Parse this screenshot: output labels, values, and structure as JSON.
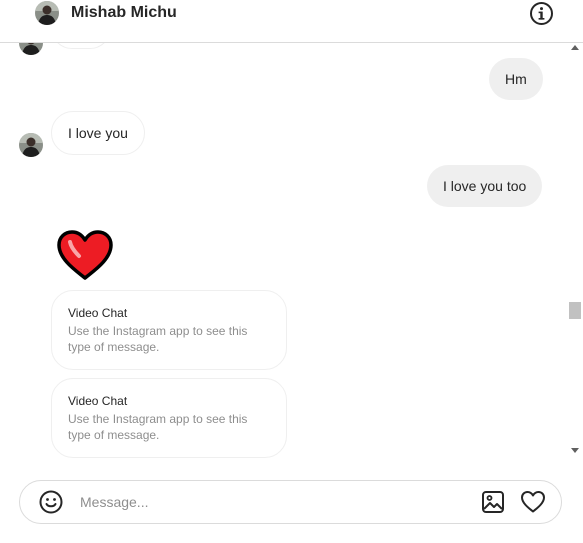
{
  "header": {
    "contact_name": "Mishab Michu",
    "avatar_icon": "profile-avatar",
    "info_icon": "info-icon"
  },
  "thread": {
    "messages": [
      {
        "direction": "outgoing",
        "text": "Hm"
      },
      {
        "direction": "incoming",
        "text": "I love you"
      },
      {
        "direction": "outgoing",
        "text": "I love you too"
      },
      {
        "direction": "incoming",
        "type": "emoji",
        "icon": "red-heart-icon"
      },
      {
        "direction": "incoming",
        "type": "card",
        "title": "Video Chat",
        "body": "Use the Instagram app to see this type of message."
      },
      {
        "direction": "incoming",
        "type": "card",
        "title": "Video Chat",
        "body": "Use the Instagram app to see this type of message."
      }
    ]
  },
  "composer": {
    "placeholder": "Message...",
    "emoji_icon": "smiley-icon",
    "image_icon": "image-icon",
    "like_icon": "heart-outline-icon"
  },
  "colors": {
    "outgoing_bubble": "#efefef",
    "border": "#dbdbdb",
    "heart_red": "#ed1c24",
    "text": "#262626",
    "muted": "#8e8e8e"
  }
}
